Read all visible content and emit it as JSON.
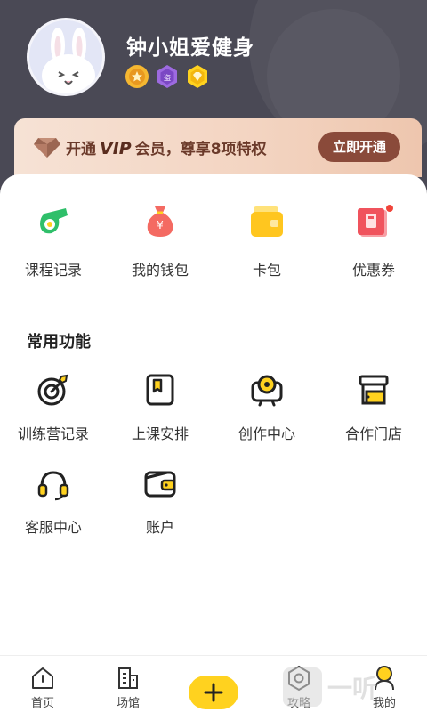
{
  "profile": {
    "username": "钟小姐爱健身",
    "badges": [
      "star-badge-icon",
      "membership-badge-icon",
      "diamond-badge-icon"
    ]
  },
  "vip": {
    "prefix": "开通",
    "vip_word": "VIP",
    "suffix": "会员，尊享8项特权",
    "button_label": "立即开通"
  },
  "quick_actions": [
    {
      "label": "课程记录",
      "icon": "whistle-icon"
    },
    {
      "label": "我的钱包",
      "icon": "money-bag-icon"
    },
    {
      "label": "卡包",
      "icon": "card-wallet-icon"
    },
    {
      "label": "优惠券",
      "icon": "coupon-icon",
      "has_dot": true
    }
  ],
  "common_functions": {
    "title": "常用功能",
    "items": [
      {
        "label": "训练营记录",
        "icon": "target-icon"
      },
      {
        "label": "上课安排",
        "icon": "schedule-book-icon"
      },
      {
        "label": "创作中心",
        "icon": "camera-icon"
      },
      {
        "label": "合作门店",
        "icon": "store-icon"
      },
      {
        "label": "客服中心",
        "icon": "headset-icon"
      },
      {
        "label": "账户",
        "icon": "wallet-icon"
      }
    ]
  },
  "bottom_nav": [
    {
      "label": "首页",
      "icon": "home-icon"
    },
    {
      "label": "场馆",
      "icon": "building-icon"
    },
    {
      "label": "",
      "icon": "plus-icon"
    },
    {
      "label": "攻略",
      "icon": "hexagon-icon"
    },
    {
      "label": "我的",
      "icon": "profile-icon",
      "active": true
    }
  ],
  "watermark": {
    "text": "一听"
  },
  "colors": {
    "header_bg": "#4a4955",
    "accent_yellow": "#ffd21f",
    "vip_button": "#8a4a3a",
    "red_dot": "#f0443a"
  }
}
